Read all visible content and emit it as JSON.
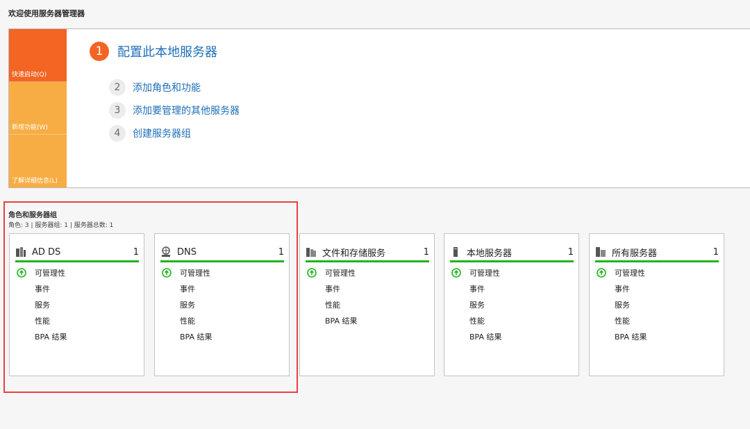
{
  "welcome": {
    "title": "欢迎使用服务器管理器",
    "quick_start": [
      {
        "label": "快速启动(Q)",
        "active": true
      },
      {
        "label": "新增功能(W)",
        "active": false
      },
      {
        "label": "了解详细信息(L)",
        "active": false
      }
    ],
    "main_step": {
      "num": "1",
      "label": "配置此本地服务器"
    },
    "steps": [
      {
        "num": "2",
        "label": "添加角色和功能"
      },
      {
        "num": "3",
        "label": "添加要管理的其他服务器"
      },
      {
        "num": "4",
        "label": "创建服务器组"
      }
    ]
  },
  "roles": {
    "title": "角色和服务器组",
    "summary": "角色: 3 | 服务器组: 1 | 服务器总数: 1",
    "tiles": [
      {
        "name": "AD DS",
        "count": "1",
        "icon": "ad-ds-icon",
        "rows": [
          "可管理性",
          "事件",
          "服务",
          "性能",
          "BPA 结果"
        ]
      },
      {
        "name": "DNS",
        "count": "1",
        "icon": "dns-icon",
        "rows": [
          "可管理性",
          "事件",
          "服务",
          "性能",
          "BPA 结果"
        ]
      },
      {
        "name": "文件和存储服务",
        "count": "1",
        "icon": "file-storage-icon",
        "rows": [
          "可管理性",
          "事件",
          "性能",
          "BPA 结果"
        ]
      },
      {
        "name": "本地服务器",
        "count": "1",
        "icon": "local-server-icon",
        "rows": [
          "可管理性",
          "事件",
          "服务",
          "性能",
          "BPA 结果"
        ]
      },
      {
        "name": "所有服务器",
        "count": "1",
        "icon": "all-servers-icon",
        "rows": [
          "可管理性",
          "事件",
          "服务",
          "性能",
          "BPA 结果"
        ]
      }
    ]
  },
  "colors": {
    "accent_orange": "#f26522",
    "tile_orange": "#f7ad44",
    "link_blue": "#1e6fb8",
    "status_green": "#1eb41e",
    "highlight_red": "#e84040"
  }
}
